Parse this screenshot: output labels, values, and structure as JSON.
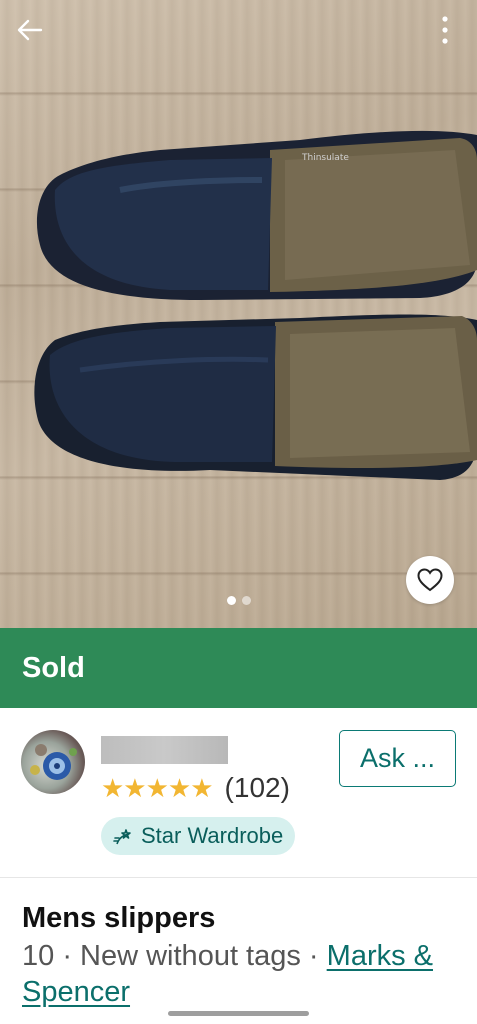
{
  "photo": {
    "image_count": 2,
    "active_index": 0,
    "label_on_shoe": "Thinsulate"
  },
  "status_banner": {
    "label": "Sold",
    "color": "#2e8a57"
  },
  "seller": {
    "rating_stars": "★★★★★",
    "rating_value": 5,
    "review_count": "(102)",
    "badge_label": "Star Wardrobe",
    "ask_button_label": "Ask ..."
  },
  "item": {
    "title": "Mens slippers",
    "size": "10",
    "separator": " · ",
    "condition": "New without tags",
    "brand": "Marks & Spencer"
  },
  "icons": {
    "back": "arrow-left-icon",
    "more": "more-vertical-icon",
    "favorite": "heart-outline-icon",
    "badge": "star-wardrobe-icon"
  },
  "colors": {
    "accent": "#0b6f6b",
    "badge_bg": "#d6f0ee",
    "star": "#f2b632"
  }
}
